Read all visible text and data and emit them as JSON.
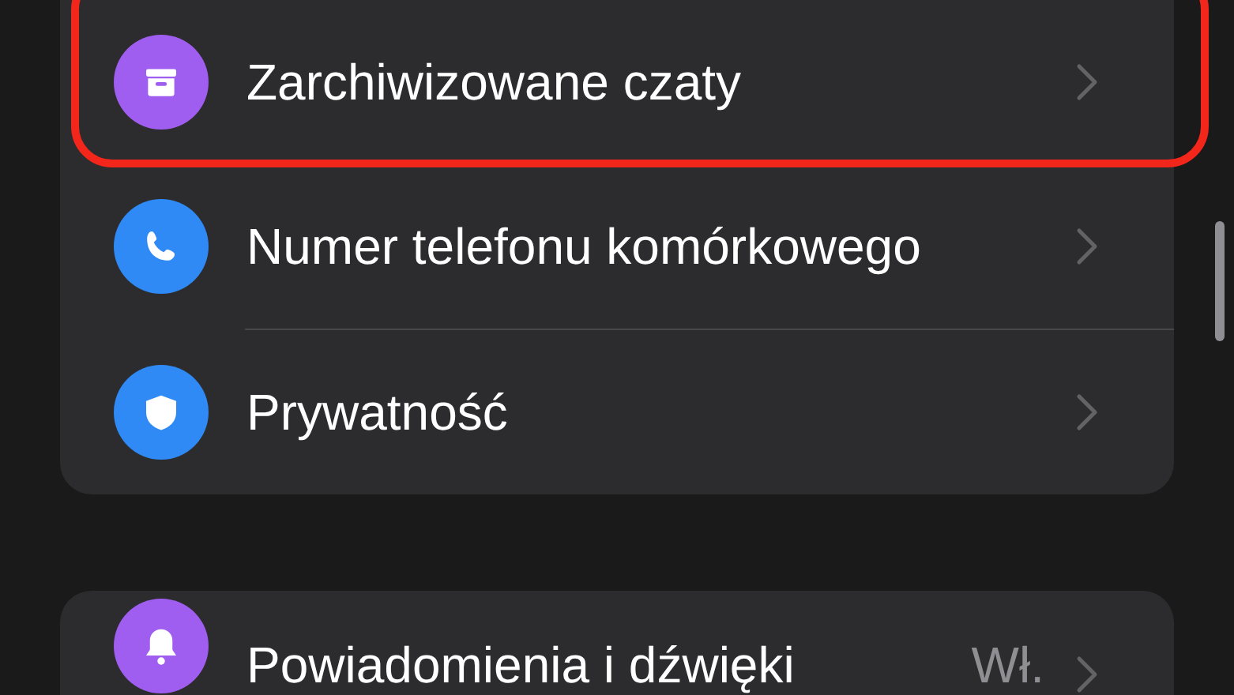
{
  "sections": [
    {
      "rows": [
        {
          "kind": "archive",
          "color": "#a05ef0",
          "label": "Zarchiwizowane czaty",
          "highlighted": true
        },
        {
          "kind": "phone",
          "color": "#2f8af5",
          "label": "Numer telefonu komórkowego",
          "highlighted": false
        },
        {
          "kind": "shield",
          "color": "#2f8af5",
          "label": "Prywatność",
          "highlighted": false
        }
      ]
    },
    {
      "rows": [
        {
          "kind": "bell",
          "color": "#a05ef0",
          "label": "Powiadomienia i dźwięki",
          "value": "Wł.",
          "highlighted": false
        }
      ]
    }
  ]
}
